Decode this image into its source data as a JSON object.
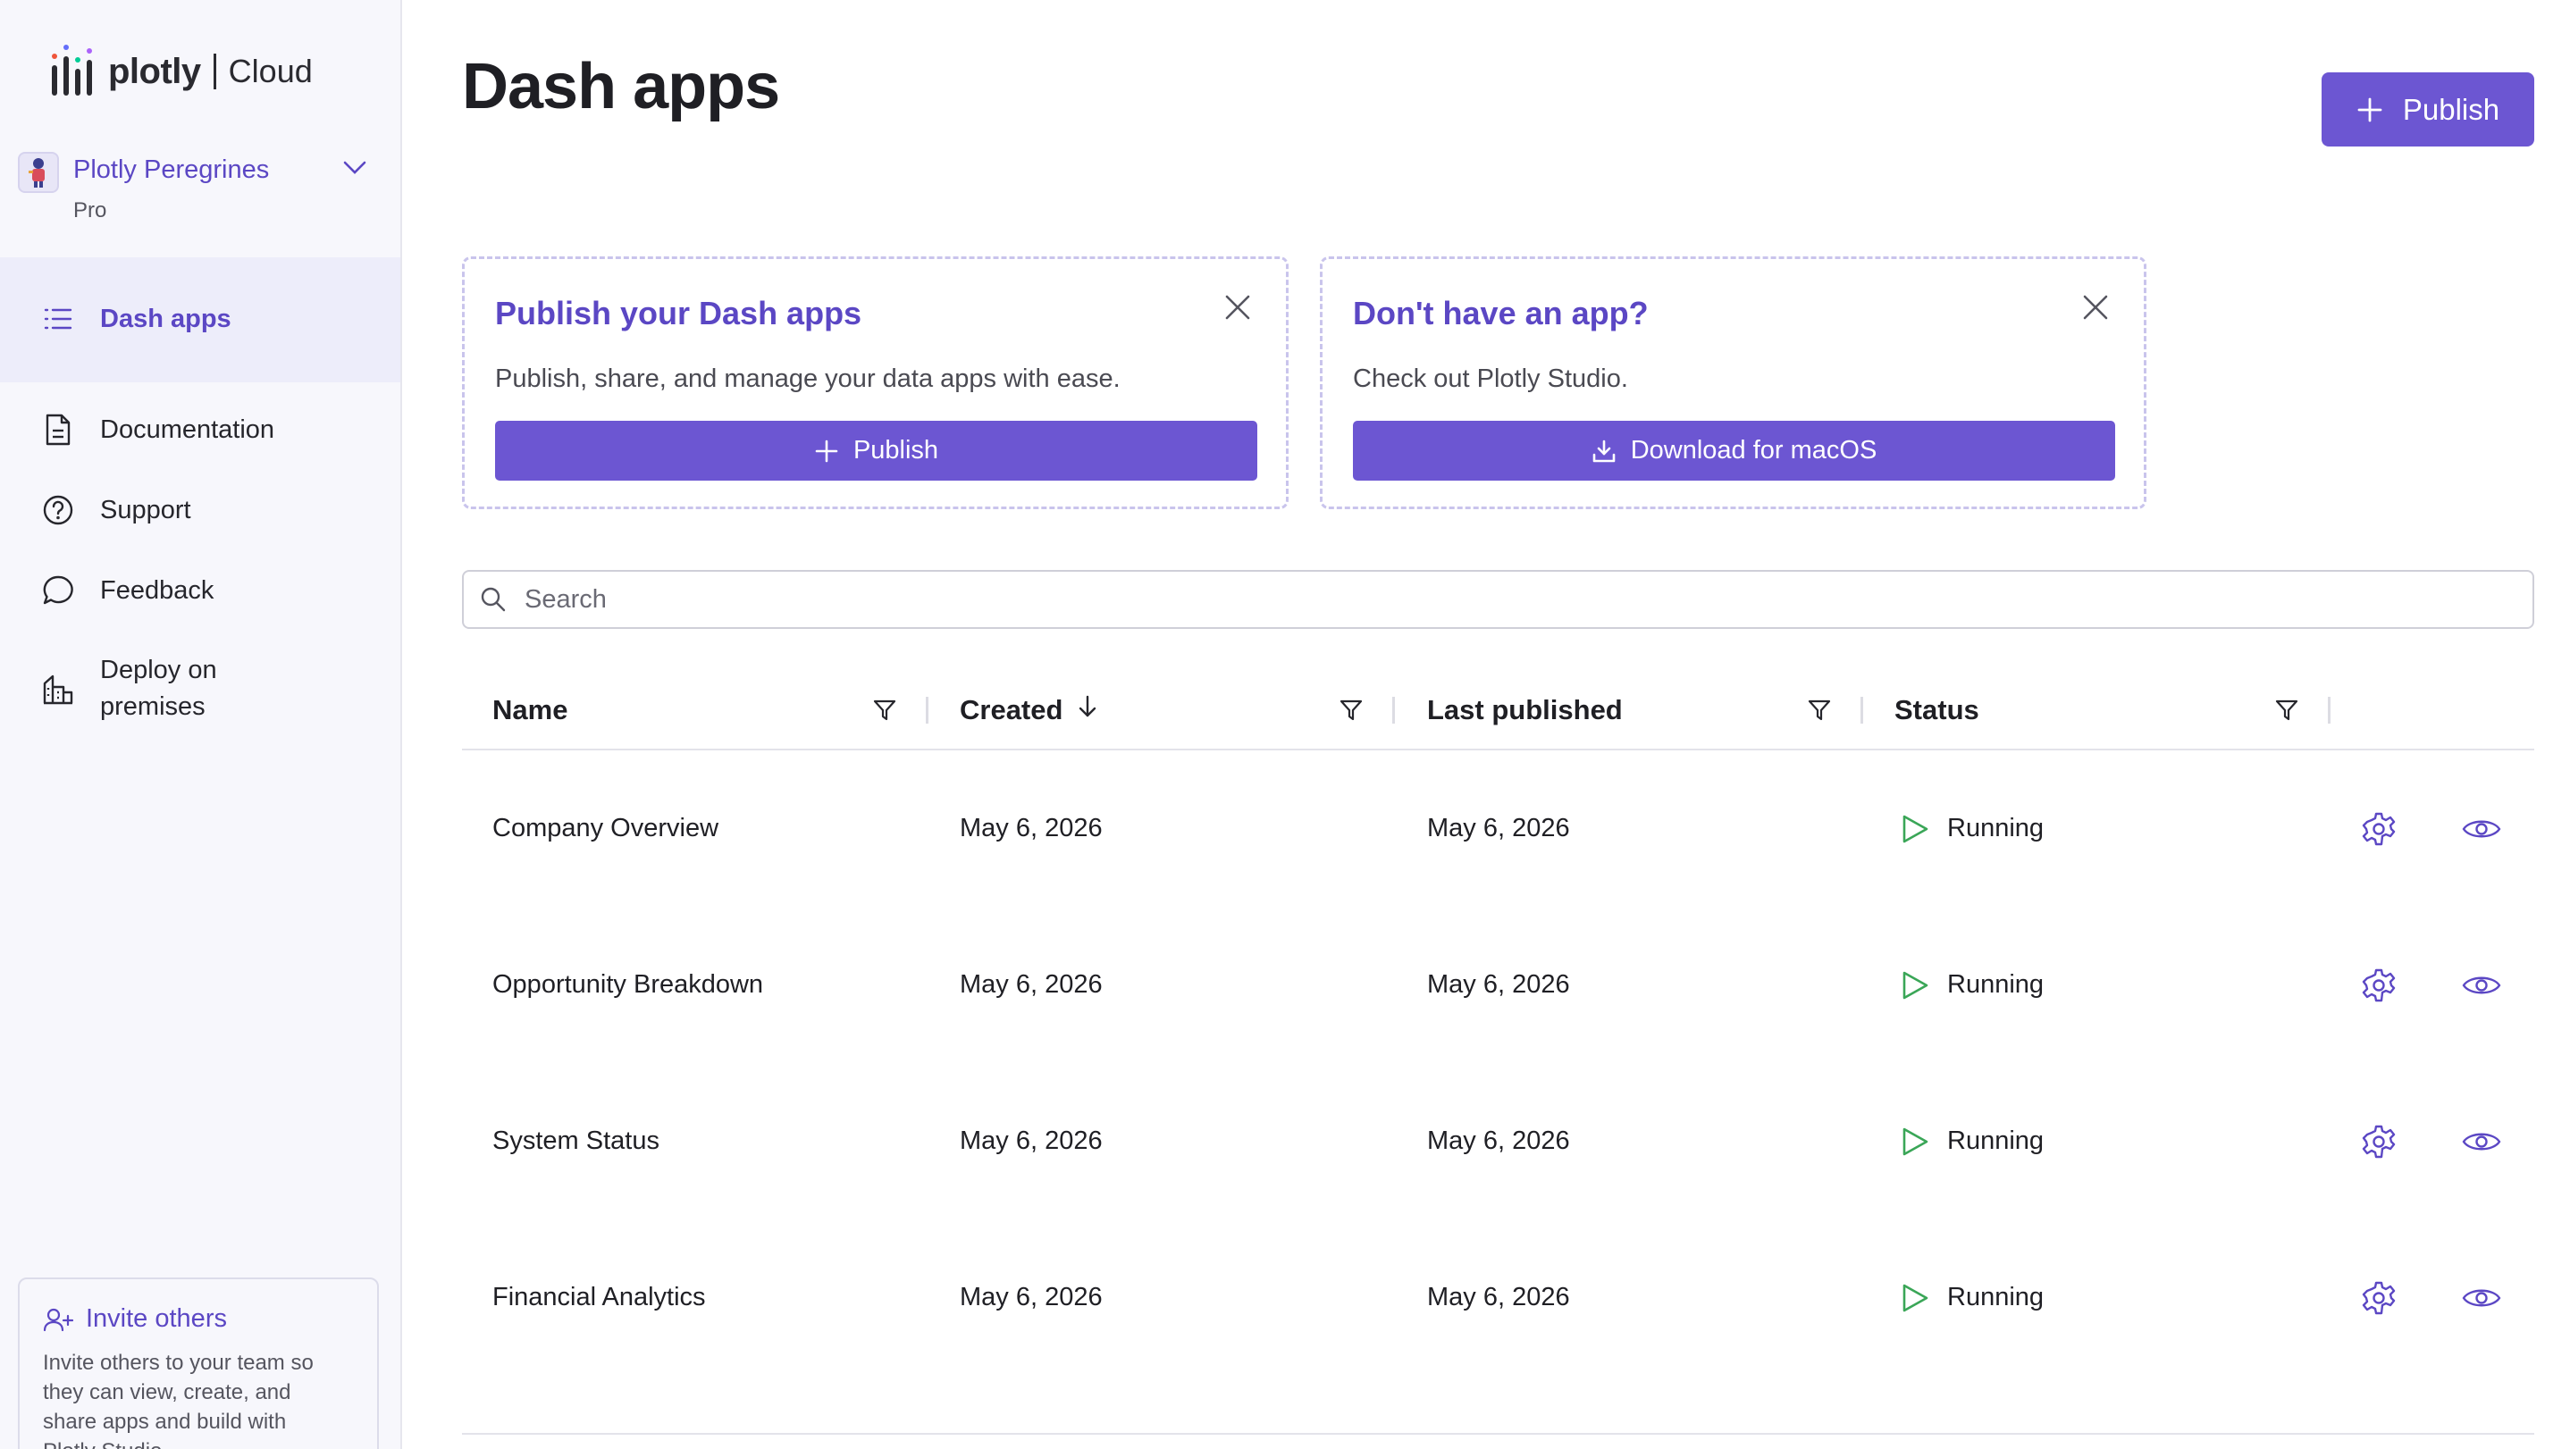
{
  "brand": {
    "word": "plotly",
    "product": "Cloud"
  },
  "team": {
    "name": "Plotly Peregrines",
    "plan": "Pro"
  },
  "nav": {
    "items": [
      {
        "label": "Dash apps",
        "icon": "list-icon",
        "active": true
      },
      {
        "label": "Documentation",
        "icon": "document-icon"
      },
      {
        "label": "Support",
        "icon": "help-circle-icon"
      },
      {
        "label": "Feedback",
        "icon": "chat-bubble-icon"
      },
      {
        "label_line1": "Deploy on",
        "label_line2": "premises",
        "icon": "building-icon"
      }
    ]
  },
  "invite": {
    "title": "Invite others",
    "line1": "Invite others to your team so",
    "line2": "they can view, create, and",
    "line3": "share apps and build with",
    "line4": "Plotly Studio"
  },
  "page": {
    "title": "Dash apps",
    "publish_label": "Publish"
  },
  "cards": [
    {
      "title": "Publish your Dash apps",
      "description": "Publish, share, and manage your data apps with ease.",
      "button_label": "Publish"
    },
    {
      "title": "Don't have an app?",
      "description": "Check out Plotly Studio.",
      "button_label": "Download for macOS"
    }
  ],
  "search": {
    "placeholder": "Search"
  },
  "table": {
    "columns": [
      "Name",
      "Created",
      "Last published",
      "Status"
    ],
    "rows": [
      {
        "name": "Company Overview",
        "created": "May 6, 2026",
        "published": "May 6, 2026",
        "status": "Running"
      },
      {
        "name": "Opportunity Breakdown",
        "created": "May 6, 2026",
        "published": "May 6, 2026",
        "status": "Running"
      },
      {
        "name": "System Status",
        "created": "May 6, 2026",
        "published": "May 6, 2026",
        "status": "Running"
      },
      {
        "name": "Financial Analytics",
        "created": "May 6, 2026",
        "published": "May 6, 2026",
        "status": "Running"
      }
    ]
  },
  "colors": {
    "accent": "#6c56d2",
    "accent_text": "#5b47c4",
    "running": "#3aa657",
    "sidebar_bg": "#f7f7fc"
  }
}
